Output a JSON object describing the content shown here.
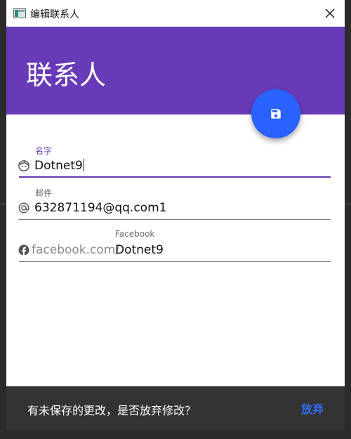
{
  "window": {
    "title": "编辑联系人"
  },
  "header": {
    "title": "联系人",
    "color": "#673ab7"
  },
  "fab": {
    "icon": "save-icon",
    "color": "#2962ff"
  },
  "fields": {
    "name": {
      "label": "名字",
      "value": "Dotnet9",
      "icon": "face-icon"
    },
    "email": {
      "label": "邮件",
      "value": "632871194@qq.com1",
      "icon": "at-icon"
    },
    "facebook": {
      "label": "Facebook",
      "prefix": "facebook.com/",
      "value": "Dotnet9",
      "icon": "facebook-icon"
    }
  },
  "snackbar": {
    "message": "有未保存的更改，是否放弃修改？",
    "action": "放弃"
  }
}
